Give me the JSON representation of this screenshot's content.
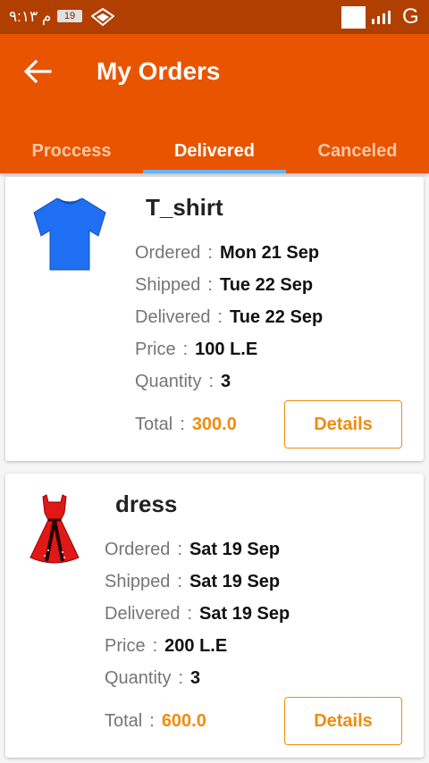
{
  "status_bar": {
    "time": "م ٩:١٣",
    "battery": "19",
    "carrier": "G"
  },
  "header": {
    "title": "My Orders"
  },
  "tabs": [
    {
      "label": "Proccess",
      "active": false
    },
    {
      "label": "Delivered",
      "active": true
    },
    {
      "label": "Canceled",
      "active": false
    }
  ],
  "labels": {
    "ordered": "Ordered",
    "shipped": "Shipped",
    "delivered": "Delivered",
    "price": "Price",
    "quantity": "Quantity",
    "total": "Total",
    "separator": ":",
    "details_button": "Details"
  },
  "orders": [
    {
      "name": "T_shirt",
      "image": "blue-tshirt",
      "ordered": "Mon 21 Sep",
      "shipped": "Tue 22 Sep",
      "delivered": "Tue 22 Sep",
      "price": "100  L.E",
      "quantity": "3",
      "total": "300.0"
    },
    {
      "name": "dress",
      "image": "red-dress",
      "ordered": "Sat 19 Sep",
      "shipped": "Sat 19 Sep",
      "delivered": "Sat 19 Sep",
      "price": "200  L.E",
      "quantity": "3",
      "total": "600.0"
    }
  ],
  "colors": {
    "status_bar": "#b03f00",
    "app_bar": "#e85400",
    "tab_indicator": "#64b5f6",
    "accent": "#ef8c0f"
  }
}
